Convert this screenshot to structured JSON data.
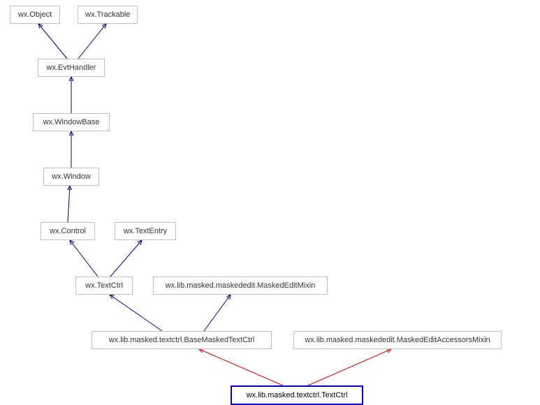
{
  "nodes": {
    "object": "wx.Object",
    "trackable": "wx.Trackable",
    "evthandler": "wx.EvtHandler",
    "windowbase": "wx.WindowBase",
    "window": "wx.Window",
    "control": "wx.Control",
    "textentry": "wx.TextEntry",
    "textctrl": "wx.TextCtrl",
    "maskededitmixin": "wx.lib.masked.maskededit.MaskedEditMixin",
    "basemaskedtextctrl": "wx.lib.masked.textctrl.BaseMaskedTextCtrl",
    "maskededitaccessorsmixin": "wx.lib.masked.maskededit.MaskedEditAccessorsMixin",
    "final": "wx.lib.masked.textctrl.TextCtrl"
  },
  "chart_data": {
    "type": "hierarchy",
    "title": "Class inheritance diagram",
    "nodes": [
      "wx.Object",
      "wx.Trackable",
      "wx.EvtHandler",
      "wx.WindowBase",
      "wx.Window",
      "wx.Control",
      "wx.TextEntry",
      "wx.TextCtrl",
      "wx.lib.masked.maskededit.MaskedEditMixin",
      "wx.lib.masked.textctrl.BaseMaskedTextCtrl",
      "wx.lib.masked.maskededit.MaskedEditAccessorsMixin",
      "wx.lib.masked.textctrl.TextCtrl"
    ],
    "edges": [
      {
        "from": "wx.EvtHandler",
        "to": "wx.Object",
        "color": "navy"
      },
      {
        "from": "wx.EvtHandler",
        "to": "wx.Trackable",
        "color": "navy"
      },
      {
        "from": "wx.WindowBase",
        "to": "wx.EvtHandler",
        "color": "navy"
      },
      {
        "from": "wx.Window",
        "to": "wx.WindowBase",
        "color": "navy"
      },
      {
        "from": "wx.Control",
        "to": "wx.Window",
        "color": "navy"
      },
      {
        "from": "wx.TextCtrl",
        "to": "wx.Control",
        "color": "navy"
      },
      {
        "from": "wx.TextCtrl",
        "to": "wx.TextEntry",
        "color": "navy"
      },
      {
        "from": "wx.lib.masked.textctrl.BaseMaskedTextCtrl",
        "to": "wx.TextCtrl",
        "color": "navy"
      },
      {
        "from": "wx.lib.masked.textctrl.BaseMaskedTextCtrl",
        "to": "wx.lib.masked.maskededit.MaskedEditMixin",
        "color": "navy"
      },
      {
        "from": "wx.lib.masked.textctrl.TextCtrl",
        "to": "wx.lib.masked.textctrl.BaseMaskedTextCtrl",
        "color": "red"
      },
      {
        "from": "wx.lib.masked.textctrl.TextCtrl",
        "to": "wx.lib.masked.maskededit.MaskedEditAccessorsMixin",
        "color": "red"
      }
    ],
    "highlighted_node": "wx.lib.masked.textctrl.TextCtrl"
  }
}
